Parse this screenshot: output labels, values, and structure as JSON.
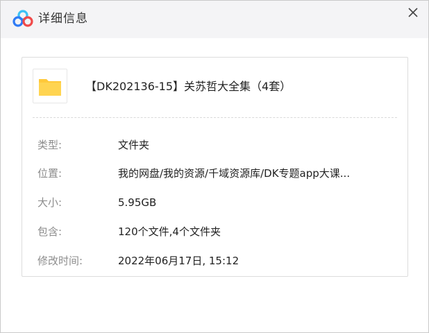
{
  "window": {
    "title": "详细信息",
    "logo_icon": "baidu-netdisk-cloud-icon",
    "close_icon": "close-icon"
  },
  "file": {
    "icon": "folder-icon",
    "name": "【DK202136-15】关苏哲大全集（4套）"
  },
  "details": [
    {
      "label": "类型:",
      "value": "文件夹"
    },
    {
      "label": "位置:",
      "value": "我的网盘/我的资源/千域资源库/DK专题app大课..."
    },
    {
      "label": "大小:",
      "value": "5.95GB"
    },
    {
      "label": "包含:",
      "value": "120个文件,4个文件夹"
    },
    {
      "label": "修改时间:",
      "value": "2022年06月17日, 15:12"
    }
  ],
  "colors": {
    "logo_blue": "#2f7bf5",
    "logo_cyan": "#3cc2f5",
    "logo_red": "#f04a4a",
    "folder_yellow": "#ffc93a",
    "label_gray": "#8c8c8c"
  }
}
